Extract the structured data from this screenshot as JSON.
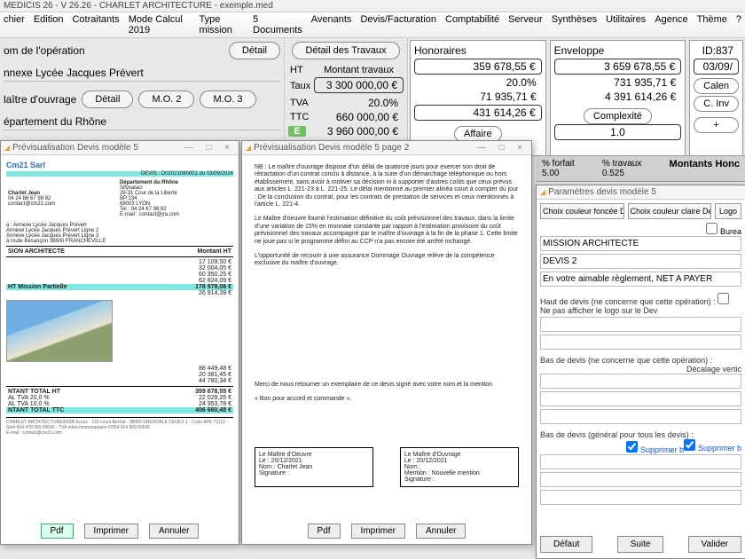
{
  "title": "MEDICIS 26  - V 26.26 - CHARLET ARCHITECTURE - exemple.med",
  "menu": [
    "chier",
    "Edition",
    "Cotraitants",
    "Mode Calcul 2019",
    "Type mission",
    "5 Documents",
    "Avenants",
    "Devis/Facturation",
    "Comptabilité",
    "Serveur",
    "Synthèses",
    "Utilitaires",
    "Agence",
    "Thème",
    "?"
  ],
  "left": {
    "op_label": "om de l'opération",
    "detail": "Détail",
    "op_value": "nnexe Lycée Jacques Prévert",
    "mo_label": "laître d'ouvrage",
    "mo2": "M.O. 2",
    "mo3": "M.O. 3",
    "dept": "épartement du Rhône"
  },
  "mid": {
    "detail_travaux": "Détail des Travaux",
    "ht": "HT",
    "taux": "Taux",
    "tva": "TVA",
    "ttc": "TTC",
    "montant_label": "Montant travaux",
    "montant": "3 300 000,00 €",
    "taux_val": "20.0%",
    "tva_val": "660 000,00 €",
    "ttc_val": "3 960 000,00 €",
    "E": "E"
  },
  "honoraires": {
    "title": "Honoraires",
    "v1": "359 678,55 €",
    "pct": "20.0%",
    "v2": "71 935,71 €",
    "v3": "431 614,26 €",
    "affaire": "Affaire"
  },
  "enveloppe": {
    "title": "Enveloppe",
    "v1": "3 659 678,55 €",
    "v2": "731 935,71 €",
    "v3": "4 391 614,26 €",
    "complexite": "Complexité",
    "cx_val": "1.0"
  },
  "rightcol": {
    "id": "ID:837",
    "date": "03/09/",
    "calen": "Calen",
    "cinv": "C. Inv",
    "plus": "+"
  },
  "montbar": {
    "forfait": "% forfait",
    "forfait_v": "5.00",
    "travaux": "% travaux",
    "travaux_v": "0.525",
    "title": "Montants Honc"
  },
  "d1": {
    "title": "Prévisualisation Devis modèle 5",
    "company": "Cm21 Sarl",
    "devis_ref": "DEVIS : D02021080001 du 03/09/2024",
    "from_name": "Charlet Jean",
    "from_tel": "04 24 88 67 98 82",
    "from_mail": "contact@cm21.com",
    "to_dept": "Département du Rhône",
    "to_svc": "Sifyvataci",
    "to_addr1": "29-31 Cour de la Liberté",
    "to_bp": "BP 234",
    "to_city": "69003 LYON",
    "to_tel": "Tel : 04 24 67 98 82",
    "to_mail": "E-mail : contact@jra.com",
    "obj_l1": "a : Annexe Lycée Jacques Prévert",
    "obj_l2": "Annexe Lycée Jacques Prévert Ligne 2",
    "obj_l3": "Annexe Lycée Jacques Prévert Ligne 3",
    "obj_l4": "à route Besançon 38600 FRANCHEVILLE",
    "mission": "SION ARCHITECTE",
    "col_m": "Montant HT",
    "rows": [
      [
        "",
        "17 109,50 €"
      ],
      [
        "",
        "32 004,05 €"
      ],
      [
        "",
        "60 350,25 €"
      ],
      [
        "",
        "62 824,09 €"
      ],
      [
        "HT Mission Partielle",
        "178 978,08 €"
      ],
      [
        "",
        "26 914,39 €"
      ]
    ],
    "rows2": [
      [
        "",
        "88 449,48 €"
      ],
      [
        "",
        "20 381,45 €"
      ],
      [
        "",
        "44 780,34 €"
      ]
    ],
    "tot": [
      [
        "NTANT TOTAL HT",
        "359 678,55 €"
      ],
      [
        "AL TVA 20,0 %",
        "22 028,26 €"
      ],
      [
        "AL TVA 10,0 %",
        "24 953,78 €"
      ],
      [
        "NTANT TOTAL TTC",
        "406 660,48 €"
      ]
    ],
    "footer": "CHARLET ARCHITECTURE00000 Euros - 133 cours Berriat - 38000 GRENOBLE CEDEX 1 - Code APE 7111Z - Siret 424 478 999 00042 - TVA intracommunautaire FR54 424 999 00042",
    "footer2": "E-mail : contact@cm21.com",
    "btn_pdf": "Pdf",
    "btn_print": "Imprimer",
    "btn_cancel": "Annuler"
  },
  "d2": {
    "title": "Prévisualisation Devis modèle 5 page 2",
    "nb": "NB : Le maître d'ouvrage dispose d'un délai de quatorze jours pour exercer son droit de rétractation d'un contrat conclu à distance, à la suite d'un démarchage téléphonique ou hors établissement, sans avoir à motiver sa décision ni à supporter d'autres coûts que ceux prévus aux articles L. 221-23 à L. 221-25. Le délai mentionné au premier alinéa court à compter du jour : De la conclusion du contrat, pour les contrats de prestation de services et ceux mentionnés à l'article L. 221-4.",
    "p2": "Le Maître d'oeuvre fournit l'estimation définitive du coût prévisionnel des travaux, dans la limite d'une variation de 15% en monnaie constante par rapport à l'estimation provisoire du coût prévisionnel des travaux accompagné par le maître d'ouvrage à la fin de la phase 1. Cette limite ne joue pas si le programme défini au CCP n'a pas encore été arrêté inchangé.",
    "p3": "L'opportunité de recourir à une assurance Dommage Ouvrage relève de la compétence exclusive du maître d'ouvrage.",
    "p4": "Merci de nous retourner un exemplaire de ce devis signé avec votre nom et la mention",
    "p5": "« Bon pour accord et commande ».",
    "sig1_title": "Le Maître d'Oeuvre",
    "sig2_title": "Le Maître d'Ouvrage",
    "sig_date": "Le : 20/12/2021",
    "sig_nom1": "Nom : Charlet Jean",
    "sig_nom2": "Nom :",
    "sig_sign": "Signature :",
    "sig_mention": "Mention : Nouvelle mention",
    "btn_pdf": "Pdf",
    "btn_print": "Imprimer",
    "btn_cancel": "Annuler"
  },
  "d3": {
    "title": "Paramètres devis modèle 5",
    "btn_dark": "Choix couleur foncée Devis",
    "btn_light": "Choix couleur claire Devis",
    "btn_logo": "Logo",
    "cb_bureau": "Burea",
    "mission": "MISSION ARCHITECTE",
    "devis2": "DEVIS 2",
    "reglement": "En votre aimable règlement, NET A PAYER",
    "haut_lbl": "Haut de devis (ne concerne que cette opération) :",
    "cb_nologo": "Ne pas afficher le logo sur le Dev",
    "bas_lbl": "Bas de devis (ne concerne que cette opération) :",
    "decal": "Décalage vertic",
    "bas_gen_lbl": "Bas de devis  (général pour tous les devis) :",
    "supp1": "Supprimer b",
    "supp2": "Supprimer b",
    "btn_def": "Défaut",
    "btn_suite": "Suite",
    "btn_valider": "Valider"
  }
}
